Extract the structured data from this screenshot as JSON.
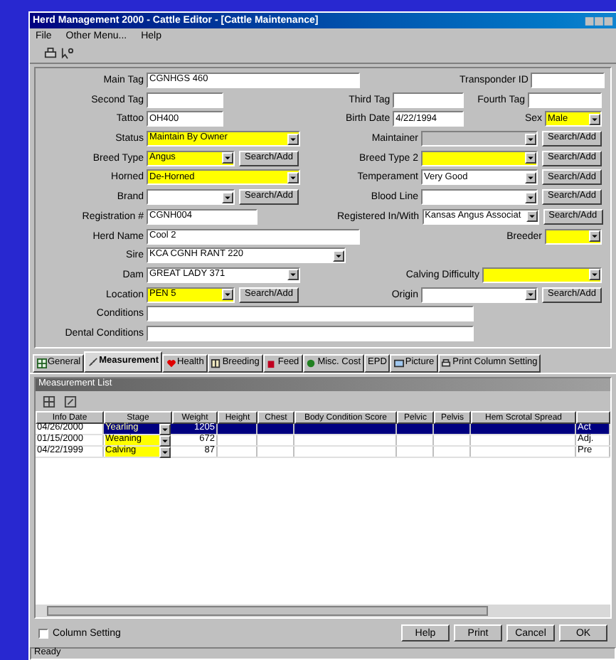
{
  "window": {
    "title": "Herd Management 2000 - Cattle Editor - [Cattle Maintenance]"
  },
  "menu": [
    "File",
    "Other Menu...",
    "Help"
  ],
  "form": {
    "rows": [
      [
        {
          "label": "Main Tag",
          "kind": "text",
          "value": "CGNHGS 460",
          "required": false,
          "disabled": false
        },
        null,
        {
          "label": "Transponder ID",
          "kind": "text",
          "required": false,
          "disabled": false
        }
      ],
      [
        {
          "label": "Second Tag",
          "kind": "text",
          "required": false,
          "disabled": false
        },
        {
          "label": "Third Tag",
          "kind": "text",
          "required": false,
          "disabled": false
        },
        {
          "label": "Fourth Tag",
          "kind": "text",
          "required": false,
          "disabled": false
        }
      ],
      [
        {
          "label": "Tattoo",
          "kind": "text",
          "value": "OH400",
          "required": false,
          "disabled": false
        },
        {
          "label": "Birth Date",
          "kind": "text",
          "value": "4/22/1994",
          "required": false,
          "disabled": false
        },
        {
          "label": "Sex",
          "kind": "combo",
          "value": "Male",
          "required": true,
          "disabled": false
        }
      ],
      [
        {
          "label": "Status",
          "kind": "combo",
          "value": "Maintain By Owner",
          "required": true,
          "disabled": false
        },
        {
          "label": "Maintainer",
          "kind": "combo",
          "required": false,
          "disabled": true,
          "button": "Search/Add"
        }
      ],
      [
        {
          "label": "Breed Type",
          "kind": "combo",
          "value": "Angus",
          "required": true,
          "disabled": false,
          "button": "Search/Add"
        },
        {
          "label": "Breed Type 2",
          "kind": "combo",
          "required": true,
          "disabled": false,
          "button": "Search/Add"
        }
      ],
      [
        {
          "label": "Horned",
          "kind": "combo",
          "value": "De-Horned",
          "required": true,
          "disabled": false
        },
        {
          "label": "Temperament",
          "kind": "combo",
          "value": "Very Good",
          "required": false,
          "disabled": false,
          "button": "Search/Add"
        }
      ],
      [
        {
          "label": "Brand",
          "kind": "combo",
          "required": false,
          "disabled": false,
          "button": "Search/Add"
        },
        {
          "label": "Blood Line",
          "kind": "combo",
          "required": false,
          "disabled": false,
          "button": "Search/Add"
        }
      ],
      [
        {
          "label": "Registration #",
          "kind": "text",
          "value": "CGNH004",
          "required": false,
          "disabled": false
        },
        {
          "label": "Registered In/With",
          "kind": "combo",
          "value": "Kansas Angus Associat",
          "required": false,
          "disabled": false,
          "button": "Search/Add"
        }
      ],
      [
        {
          "label": "Herd Name",
          "kind": "text",
          "value": "Cool 2",
          "required": false,
          "disabled": false
        },
        null,
        {
          "label": "Breeder",
          "kind": "combo",
          "required": true,
          "disabled": false
        }
      ],
      [
        {
          "label": "Sire",
          "kind": "combo",
          "value": "KCA CGNH RANT 220",
          "required": false,
          "disabled": false
        },
        null
      ],
      [
        {
          "label": "Dam",
          "kind": "combo",
          "value": "GREAT LADY 371",
          "required": false,
          "disabled": false
        },
        {
          "label": "Calving Difficulty",
          "kind": "combo",
          "required": true,
          "disabled": false
        }
      ],
      [
        {
          "label": "Location",
          "kind": "combo",
          "value": "PEN 5",
          "required": true,
          "disabled": false,
          "button": "Search/Add"
        },
        {
          "label": "Origin",
          "kind": "combo",
          "required": false,
          "disabled": false,
          "button": "Search/Add"
        }
      ],
      [
        {
          "label": "Conditions",
          "kind": "text",
          "required": false,
          "disabled": false
        }
      ],
      [
        {
          "label": "Dental Conditions",
          "kind": "text",
          "required": false,
          "disabled": false
        }
      ]
    ]
  },
  "tabs": [
    {
      "label": "General",
      "selected": false
    },
    {
      "label": "Measurement",
      "selected": true
    },
    {
      "label": "Health",
      "selected": false
    },
    {
      "label": "Breeding",
      "selected": false
    },
    {
      "label": "Feed",
      "selected": false
    },
    {
      "label": "Misc. Cost",
      "selected": false
    },
    {
      "label": "EPD",
      "selected": false
    },
    {
      "label": "Picture",
      "selected": false
    },
    {
      "label": "Print Column Setting",
      "selected": false
    }
  ],
  "measurements": {
    "title": "Measurement List",
    "columns": [
      "Info Date",
      "Stage",
      "Weight",
      "Height",
      "Chest",
      "Body Condition Score",
      "Pelvic",
      "Pelvis",
      "Hem Scrotal Spread"
    ],
    "rows": [
      {
        "selected": true,
        "info_date": "04/26/2000",
        "stage": "Yearling",
        "stage_required": true,
        "weight": "1205",
        "column_10": "Act"
      },
      {
        "selected": false,
        "info_date": "01/15/2000",
        "stage": "Weaning",
        "stage_required": true,
        "weight": "672",
        "column_10": "Adj."
      },
      {
        "selected": false,
        "info_date": "04/22/1999",
        "stage": "Calving",
        "stage_required": true,
        "weight": "87",
        "column_10": "Pre"
      }
    ]
  },
  "column_setting": {
    "label": "Column Setting",
    "checked": false
  },
  "buttons": [
    "Help",
    "Print",
    "Cancel",
    "OK"
  ],
  "status_bar": "Ready"
}
